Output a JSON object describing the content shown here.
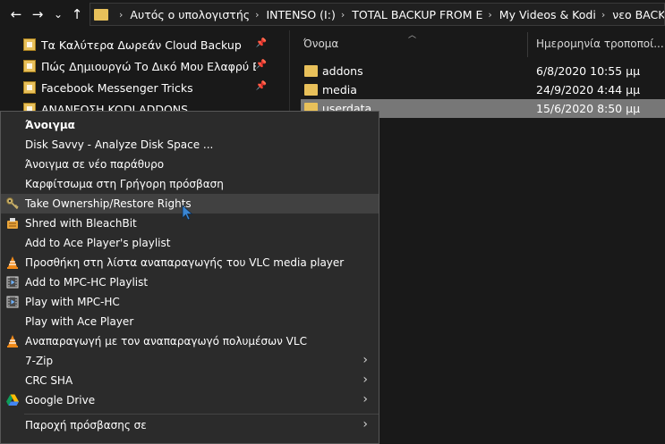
{
  "nav": {
    "back_icon": "←",
    "forward_icon": "→",
    "recent_icon": "⌄",
    "up_icon": "↑"
  },
  "address": {
    "crumbs": [
      "Αυτός ο υπολογιστής",
      "INTENSO (I:)",
      "TOTAL BACKUP FROM E",
      "My Videos & Kodi",
      "νεο BACKUP Kodi"
    ]
  },
  "quick_access": [
    "Τα Καλύτερα Δωρεάν Cloud Backup",
    "Πώς Δημιουργώ Το Δικό Μου Ελαφρύ Build",
    "Facebook Messenger Tricks",
    "ΑΝΑΝΕΩΣΗ KODI ADDONS"
  ],
  "file_list": {
    "col_name": "Όνομα",
    "col_date": "Ημερομηνία τροποποί...",
    "rows": [
      {
        "name": "addons",
        "date": "6/8/2020 10:55 μμ"
      },
      {
        "name": "media",
        "date": "24/9/2020 4:44 μμ"
      },
      {
        "name": "userdata",
        "date": "15/6/2020 8:50 μμ"
      }
    ]
  },
  "context_menu": {
    "items": [
      {
        "label": "Άνοιγμα",
        "icon": ""
      },
      {
        "label": "Disk Savvy - Analyze Disk Space ...",
        "icon": ""
      },
      {
        "label": "Άνοιγμα σε νέο παράθυρο",
        "icon": ""
      },
      {
        "label": "Καρφίτσωμα στη Γρήγορη πρόσβαση",
        "icon": ""
      },
      {
        "label": "Take Ownership/Restore Rights",
        "icon": "key-icon"
      },
      {
        "label": "Shred with BleachBit",
        "icon": "bleachbit-icon"
      },
      {
        "label": "Add to Ace Player's playlist",
        "icon": ""
      },
      {
        "label": "Προσθήκη στη λίστα αναπαραγωγής του VLC media player",
        "icon": "vlc-icon"
      },
      {
        "label": "Add to MPC-HC Playlist",
        "icon": "mpc-icon"
      },
      {
        "label": "Play with MPC-HC",
        "icon": "mpc-icon"
      },
      {
        "label": "Play with Ace Player",
        "icon": ""
      },
      {
        "label": "Αναπαραγωγή με τον αναπαραγωγό πολυμέσων VLC",
        "icon": "vlc-icon"
      },
      {
        "label": "7-Zip",
        "icon": ""
      },
      {
        "label": "CRC SHA",
        "icon": ""
      },
      {
        "label": "Google Drive",
        "icon": "google-drive-icon"
      },
      {
        "label": "Παροχή πρόσβασης σε",
        "icon": ""
      }
    ],
    "submenu_arrow": "›"
  },
  "colors": {
    "background": "#191919",
    "menu_bg": "#2b2b2b",
    "menu_hover": "#414141",
    "folder": "#e8c05a",
    "selection": "#777777",
    "cursor": "#3a86d4"
  }
}
